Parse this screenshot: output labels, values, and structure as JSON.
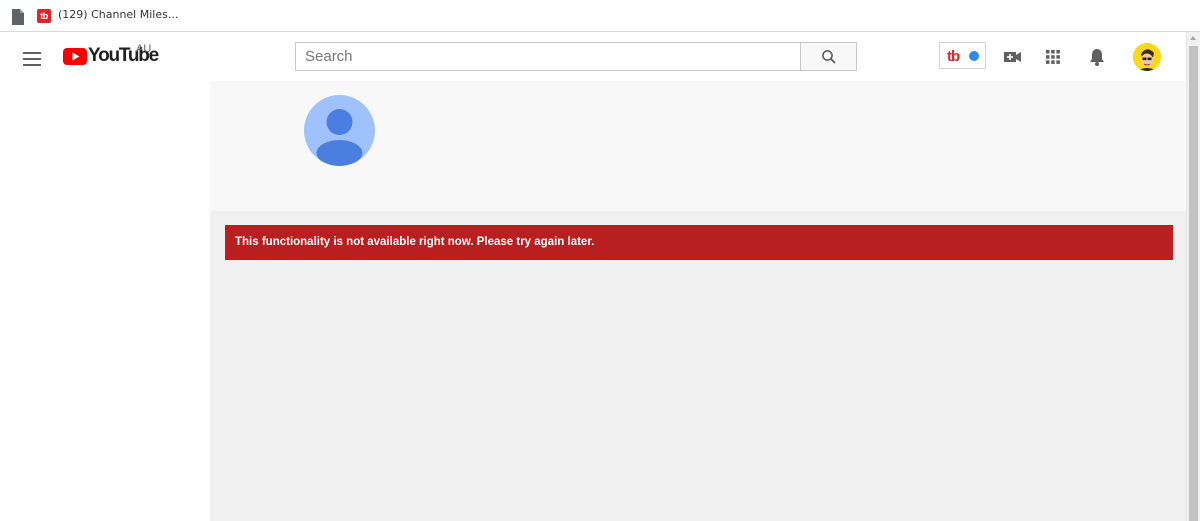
{
  "browser": {
    "tab": {
      "favicon_text": "tb",
      "title": "(129) Channel Miles..."
    }
  },
  "masthead": {
    "logo": {
      "wordmark": "YouTube",
      "region": "AU"
    },
    "search": {
      "placeholder": "Search",
      "value": ""
    },
    "tubebuddy": {
      "label": "tb",
      "status_color": "#2e8ae6"
    },
    "icons": [
      "menu-icon",
      "search-icon",
      "video-camera-add-icon",
      "apps-grid-icon",
      "notifications-bell-icon",
      "account-avatar-icon"
    ]
  },
  "channel": {
    "avatar_icon": "default-person-avatar-icon"
  },
  "error": {
    "message": "This functionality is not available right now. Please try again later."
  },
  "colors": {
    "brand_red": "#ff0000",
    "error_red": "#b91e20",
    "header_bg": "#f8f8f8",
    "content_bg": "#f0f0f0",
    "avatar_light": "#a0c2fc",
    "avatar_dark": "#4a7fdf"
  }
}
